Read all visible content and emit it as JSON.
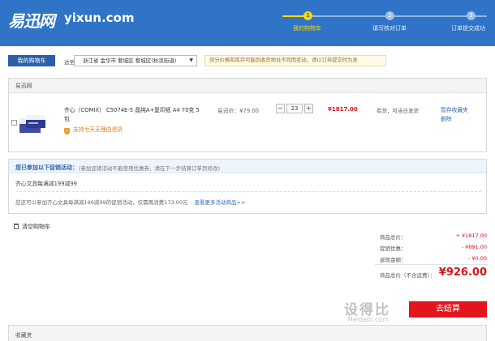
{
  "header": {
    "logo_cn": "易迅网",
    "logo_en": "yixun.com",
    "steps": [
      {
        "num": "1",
        "label": "我的购物车",
        "active": true
      },
      {
        "num": "2",
        "label": "填写核对订单",
        "active": false
      },
      {
        "num": "3",
        "label": "订单提交成功",
        "active": false
      }
    ],
    "colors": {
      "brand": "#2f74c6",
      "active_step": "#ffd800"
    }
  },
  "toolbar": {
    "cart_tab": "我的购物车",
    "ship_to_label": "送至",
    "ship_to_value": "浙江省 金华市 婺城区 婺城区(秋滨街道)",
    "notice": "部分价格和库存可能因收货地址不同而变动，请以订单提交时为准"
  },
  "store": {
    "name": "易迅网",
    "product": {
      "name": "齐心（COMIX） C5074E-5 晶纯A+复印纸 A4 70克 5包",
      "support": "支持七天无理由退货",
      "unit_price": "易迅价：¥79.00",
      "minus": "−",
      "qty": "23",
      "plus": "+",
      "total": "¥1817.00",
      "stock": "有货，可当日发货",
      "actions": [
        "暂存收藏夹",
        "删除"
      ]
    }
  },
  "promo": {
    "title": "您已参加以下促销活动：",
    "desc": "(参加促销活动不能使用优惠券，请在下一步结算订单页修改)",
    "item": "齐心文具每满减199减99",
    "info": "您还可以参加齐心文具每满减199减99的促销活动，仅需再消费173.00元",
    "more_link": "查看更多活动商品>>"
  },
  "clear_cart": "清空购物车",
  "summary": {
    "rows": [
      {
        "label": "商品总价：",
        "value": "+ ¥1817.00"
      },
      {
        "label": "促销优惠：",
        "value": "- ¥891.00"
      },
      {
        "label": "返现金额：",
        "value": "- ¥0.00"
      }
    ],
    "total_label": "商品总价（不含运费）：",
    "total_value": "¥926.00",
    "checkout": "去结算",
    "price_color": "#d8141c"
  },
  "watermark": {
    "main": "设得比",
    "site": "Meidebi.com"
  },
  "favorites": {
    "label": "收藏夹"
  }
}
